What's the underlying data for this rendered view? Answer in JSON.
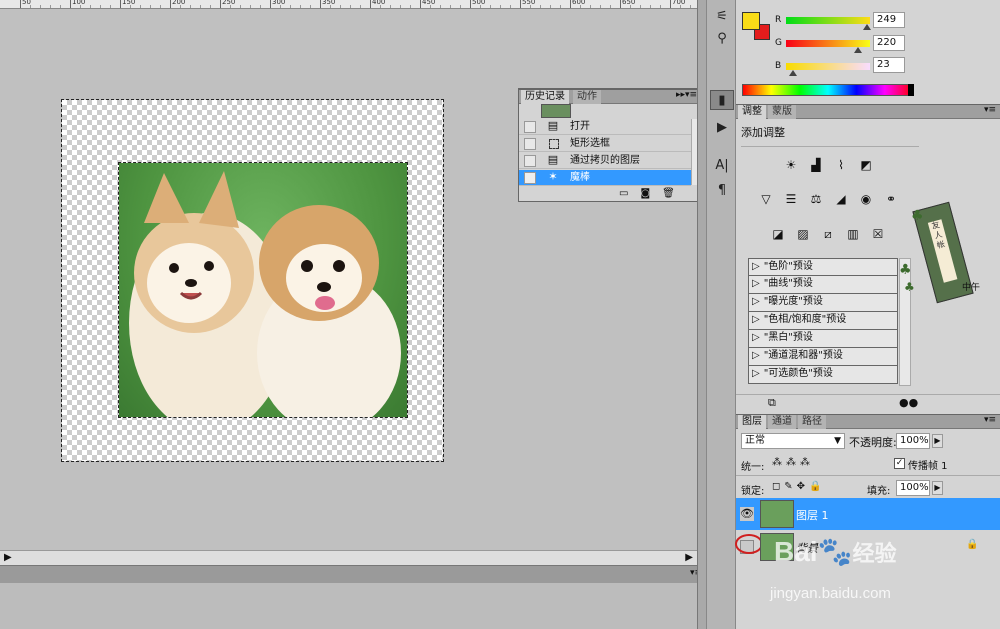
{
  "ruler": {
    "labels": [
      "50",
      "100",
      "150",
      "200",
      "250",
      "300",
      "350",
      "400",
      "450",
      "500",
      "550",
      "600",
      "650",
      "700"
    ]
  },
  "history_panel": {
    "tabs": [
      "历史记录",
      "动作"
    ],
    "items": [
      {
        "label": "打开",
        "icon": "document-icon"
      },
      {
        "label": "矩形选框",
        "icon": "marquee-icon"
      },
      {
        "label": "通过拷贝的图层",
        "icon": "document-icon"
      },
      {
        "label": "魔棒",
        "icon": "magic-wand-icon",
        "selected": true
      }
    ]
  },
  "color_panel": {
    "r_label": "R",
    "g_label": "G",
    "b_label": "B",
    "r_value": "249",
    "g_value": "220",
    "b_value": "23",
    "foreground": "#f9dc17",
    "background": "#e31c1c"
  },
  "adjustments_panel": {
    "tabs": [
      "调整",
      "蒙版"
    ],
    "title": "添加调整",
    "presets": [
      "\"色阶\"预设",
      "\"曲线\"预设",
      "\"曝光度\"预设",
      "\"色相/饱和度\"预设",
      "\"黑白\"预设",
      "\"通道混和器\"预设",
      "\"可选颜色\"预设"
    ]
  },
  "layers_panel": {
    "tabs": [
      "图层",
      "通道",
      "路径"
    ],
    "blend_mode": "正常",
    "opacity_label": "不透明度:",
    "opacity_value": "100%",
    "unify_label": "统一:",
    "propagate_label": "传播帧 1",
    "lock_label": "锁定:",
    "fill_label": "填充:",
    "fill_value": "100%",
    "layers": [
      {
        "name": "图层 1",
        "selected": true,
        "visible": true
      },
      {
        "name": "背景",
        "selected": false,
        "visible": false,
        "locked": true
      }
    ]
  },
  "overlay": {
    "seal_text": "友人帐",
    "seal_caption": "中午",
    "watermark_brand": "Bai",
    "watermark_brand2": "经验",
    "watermark_url": "jingyan.baidu.com"
  }
}
